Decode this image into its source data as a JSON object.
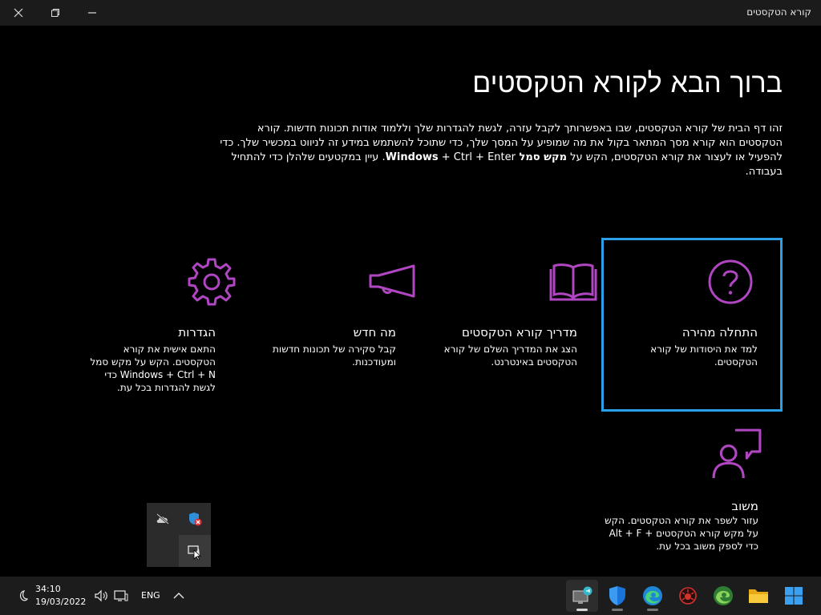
{
  "window": {
    "title": "קורא הטקסטים"
  },
  "main": {
    "heading": "ברוך הבא לקורא הטקסטים",
    "intro_text_1": "זהו דף הבית של קורא הטקסטים, שבו באפשרותך לקבל עזרה, לגשת להגדרות שלך וללמוד אודות תכונות חדשות. קורא הטקסטים הוא קורא מסך המתאר בקול את מה שמופיע על המסך שלך, כדי שתוכל להשתמש במידע זה לניווט במכשיר שלך. כדי להפעיל או לעצור את קורא הטקסטים, הקש על ",
    "intro_shortcut_label": "מקש סמל Windows",
    "intro_text_2": " + Ctrl + Enter. עיין במקטעים שלהלן כדי להתחיל בעבודה."
  },
  "cards": {
    "quickstart": {
      "title": "התחלה מהירה",
      "description": "למד את היסודות של קורא הטקסטים.",
      "icon": "question-circle-icon"
    },
    "guide": {
      "title": "מדריך קורא הטקסטים",
      "description": "הצג את המדריך השלם של קורא הטקסטים באינטרנט.",
      "icon": "open-book-icon"
    },
    "whatsnew": {
      "title": "מה חדש",
      "description": "קבל סקירה של תכונות חדשות ומעודכנות.",
      "icon": "megaphone-icon"
    },
    "settings": {
      "title": "הגדרות",
      "description": "התאם אישית את קורא הטקסטים. הקש על מקש סמל Windows + Ctrl + N כדי לגשת להגדרות בכל עת.",
      "icon": "gear-icon"
    },
    "feedback": {
      "title": "משוב",
      "description": "עזור לשפר את קורא הטקסטים. הקש על מקש קורא הטקסטים + Alt + F כדי לספק משוב בכל עת.",
      "icon": "person-feedback-icon"
    }
  },
  "taskbar": {
    "time": "34:10",
    "date": "19/03/2022",
    "language": "ENG"
  },
  "colors": {
    "accent_purple": "#b146c2",
    "focus_blue": "#2aa0e8"
  }
}
